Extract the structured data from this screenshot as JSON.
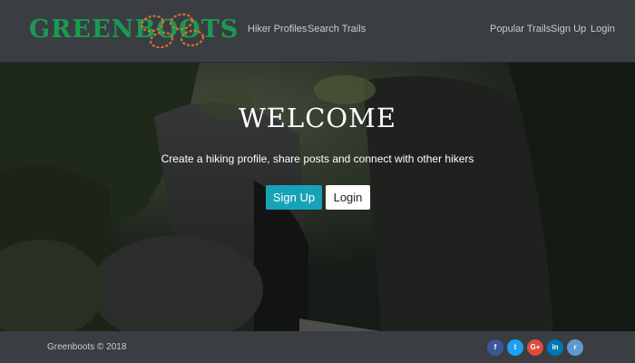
{
  "brand": {
    "name": "GREENBOOTS"
  },
  "nav": {
    "left": [
      {
        "label": "Hiker Profiles"
      },
      {
        "label": "Search Trails"
      }
    ],
    "right": [
      {
        "label": "Popular Trails"
      },
      {
        "label": "Sign Up"
      },
      {
        "label": "Login"
      }
    ]
  },
  "hero": {
    "title": "WELCOME",
    "subtitle": "Create a hiking profile, share posts and connect with other hikers",
    "signup_label": "Sign Up",
    "login_label": "Login"
  },
  "footer": {
    "copyright": "Greenboots © 2018",
    "social": [
      {
        "icon": "facebook-icon",
        "glyph": "f",
        "color": "#3b5998"
      },
      {
        "icon": "twitter-icon",
        "glyph": "t",
        "color": "#1da1f2"
      },
      {
        "icon": "google-plus-icon",
        "glyph": "G+",
        "color": "#dd4b39"
      },
      {
        "icon": "linkedin-icon",
        "glyph": "in",
        "color": "#0077b5"
      },
      {
        "icon": "reddit-icon",
        "glyph": "r",
        "color": "#5f99cf"
      }
    ]
  },
  "colors": {
    "brand": "#1b9a52",
    "navbar": "#3a3d42",
    "primary_button": "#17a2b8"
  }
}
